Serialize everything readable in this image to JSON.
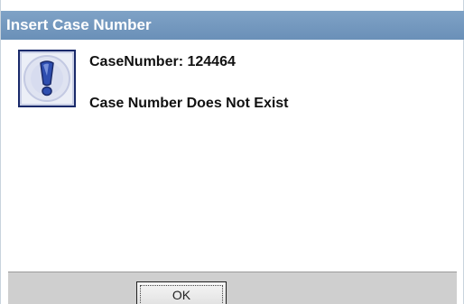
{
  "dialog": {
    "title": "Insert Case Number",
    "icon": "exclamation-icon",
    "message_line1": "CaseNumber:  124464",
    "message_line2": "Case Number Does Not Exist",
    "ok_label": "OK"
  },
  "colors": {
    "titlebar": "#7196bd",
    "titlebar_text": "#ffffff",
    "button_bar": "#cfcfcf",
    "icon_border": "#1a2a6a",
    "icon_fill": "#2e4eb0"
  }
}
